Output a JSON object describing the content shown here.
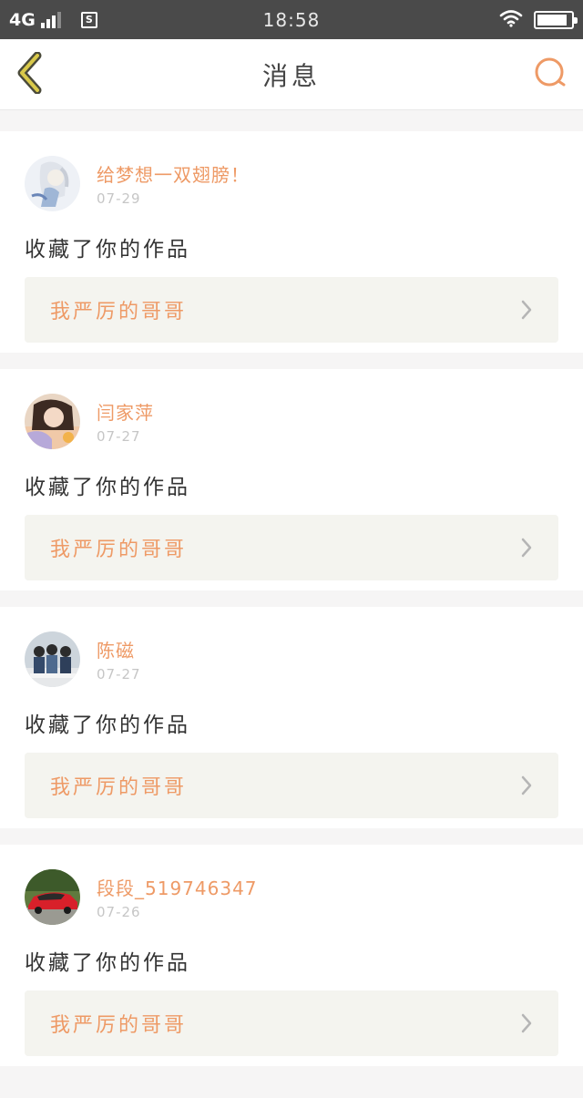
{
  "status_bar": {
    "network": "4G",
    "sim_label": "S",
    "time": "18:58",
    "battery_level": 0.9
  },
  "nav": {
    "title": "消息",
    "back_icon": "chevron-left-icon",
    "search_icon": "search-icon",
    "accent_color": "#ee9a66"
  },
  "messages": [
    {
      "username": "给梦想一双翅膀！",
      "date": "07-29",
      "action": "收藏了你的作品",
      "work_title": "我严厉的哥哥",
      "avatar": "avatar-anime-girl"
    },
    {
      "username": "闫家萍",
      "date": "07-27",
      "action": "收藏了你的作品",
      "work_title": "我严厉的哥哥",
      "avatar": "avatar-photo-woman"
    },
    {
      "username": "陈磁",
      "date": "07-27",
      "action": "收藏了你的作品",
      "work_title": "我严厉的哥哥",
      "avatar": "avatar-photo-group"
    },
    {
      "username": "段段_519746347",
      "date": "07-26",
      "action": "收藏了你的作品",
      "work_title": "我严厉的哥哥",
      "avatar": "avatar-red-car"
    }
  ]
}
